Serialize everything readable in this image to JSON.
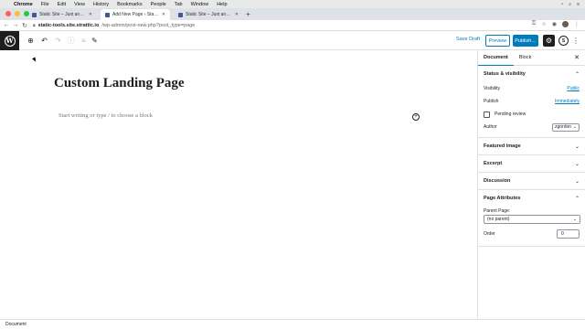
{
  "macos": {
    "menu": [
      "Chrome",
      "File",
      "Edit",
      "View",
      "History",
      "Bookmarks",
      "People",
      "Tab",
      "Window",
      "Help"
    ]
  },
  "browser": {
    "tabs": [
      {
        "title": "Static Site – Just another stati…",
        "active": false
      },
      {
        "title": "Add New Page ‹ Static Site —…",
        "active": true
      },
      {
        "title": "Static Site – Just another stati…",
        "active": false
      }
    ],
    "url_host": "static-tools.site.strattic.io",
    "url_path": "/wp-admin/post-new.php?post_type=page"
  },
  "toolbar": {
    "save_draft": "Save Draft",
    "preview": "Preview",
    "publish": "Publish…"
  },
  "editor": {
    "title": "Custom Landing Page",
    "placeholder": "Start writing or type / to choose a block"
  },
  "sidebar": {
    "tab_document": "Document",
    "tab_block": "Block",
    "status_visibility": {
      "title": "Status & visibility",
      "visibility_label": "Visibility",
      "visibility_value": "Public",
      "publish_label": "Publish",
      "publish_value": "Immediately",
      "pending_review": "Pending review",
      "author_label": "Author",
      "author_value": "zgordon"
    },
    "panels": [
      "Featured image",
      "Excerpt",
      "Discussion"
    ],
    "page_attributes": {
      "title": "Page Attributes",
      "parent_label": "Parent Page:",
      "parent_value": "(no parent)",
      "order_label": "Order",
      "order_value": "0"
    }
  },
  "footer": {
    "breadcrumb": "Document"
  },
  "colors": {
    "accent": "#007cba",
    "dark": "#1e1e1e"
  }
}
